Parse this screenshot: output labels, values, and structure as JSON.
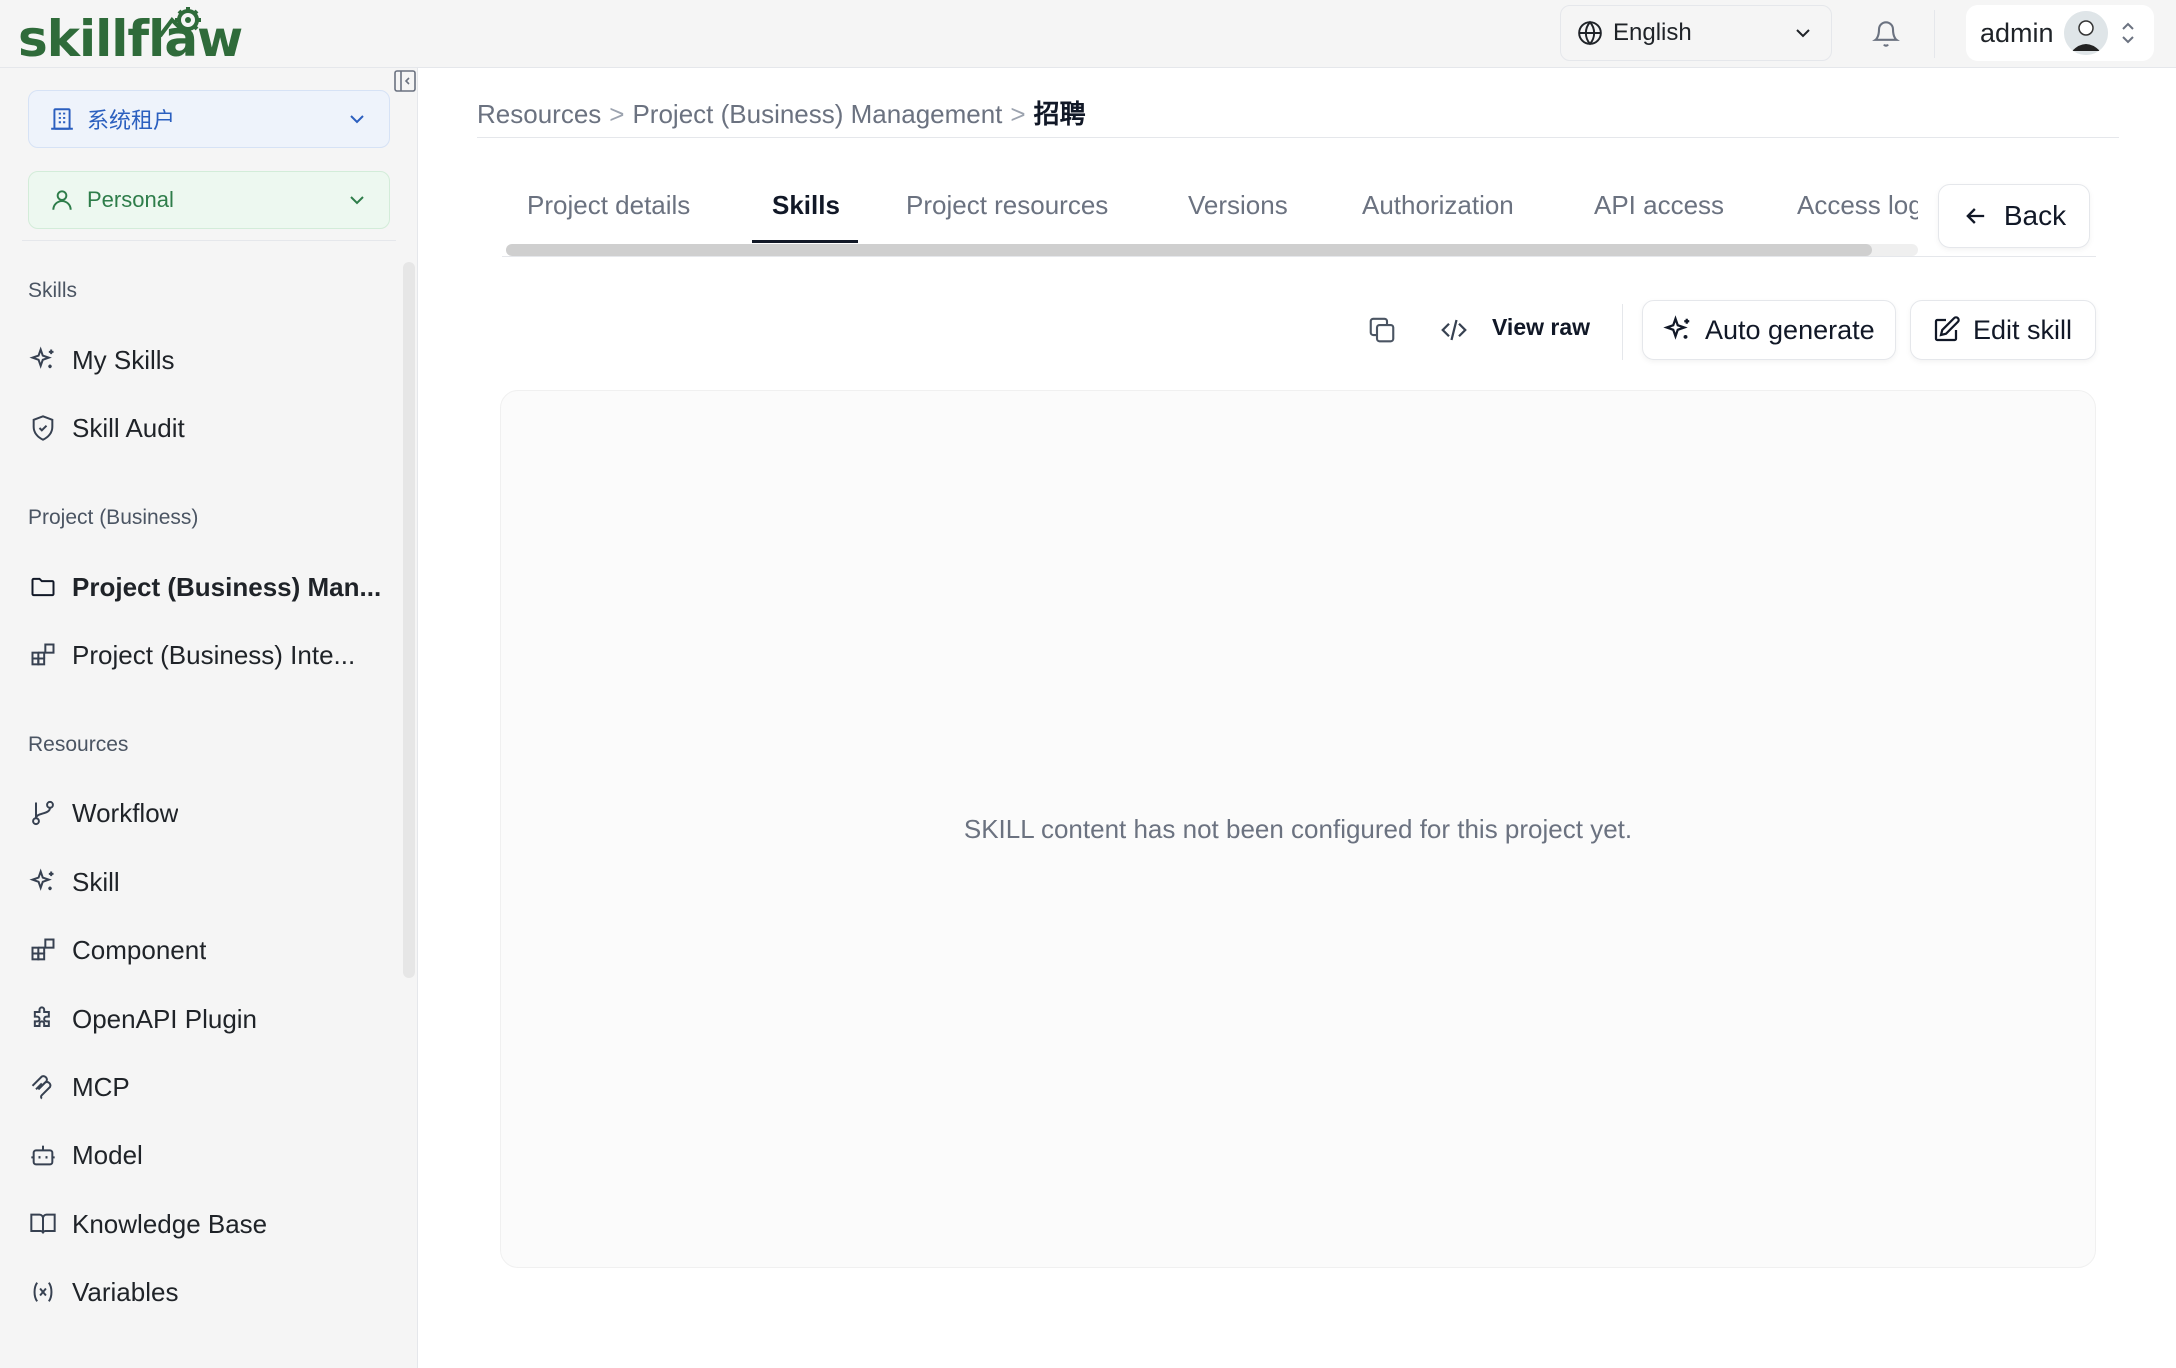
{
  "app": {
    "logo_text": "skillflaw"
  },
  "topbar": {
    "language": "English",
    "user_name": "admin"
  },
  "sidebar": {
    "tenant_selector": "系统租户",
    "space_selector": "Personal",
    "sections": [
      {
        "title": "Skills",
        "items": [
          {
            "label": "My Skills",
            "icon": "sparkles-icon"
          },
          {
            "label": "Skill Audit",
            "icon": "shield-check-icon"
          }
        ]
      },
      {
        "title": "Project (Business)",
        "items": [
          {
            "label": "Project (Business) Man...",
            "icon": "folder-icon",
            "active": true
          },
          {
            "label": "Project (Business) Inte...",
            "icon": "blocks-icon"
          }
        ]
      },
      {
        "title": "Resources",
        "items": [
          {
            "label": "Workflow",
            "icon": "git-branch-icon"
          },
          {
            "label": "Skill",
            "icon": "sparkles-icon"
          },
          {
            "label": "Component",
            "icon": "blocks-icon"
          },
          {
            "label": "OpenAPI Plugin",
            "icon": "puzzle-icon"
          },
          {
            "label": "MCP",
            "icon": "mcp-icon"
          },
          {
            "label": "Model",
            "icon": "bot-icon"
          },
          {
            "label": "Knowledge Base",
            "icon": "book-open-icon"
          },
          {
            "label": "Variables",
            "icon": "variable-icon"
          }
        ]
      }
    ]
  },
  "breadcrumb": {
    "items": [
      "Resources",
      "Project (Business) Management"
    ],
    "current": "招聘",
    "separator": ">"
  },
  "tabs": {
    "items": [
      "Project details",
      "Skills",
      "Project resources",
      "Versions",
      "Authorization",
      "API access",
      "Access log"
    ],
    "active_index": 1,
    "back_label": "Back"
  },
  "toolbar": {
    "view_raw": "View raw",
    "auto_generate": "Auto generate",
    "edit_skill": "Edit skill"
  },
  "content": {
    "empty_message": "SKILL content has not been configured for this project yet."
  },
  "colors": {
    "logo_green": "#2f6b3a",
    "tenant_blue": "#2b5fbf",
    "personal_green": "#2e7d4a"
  }
}
